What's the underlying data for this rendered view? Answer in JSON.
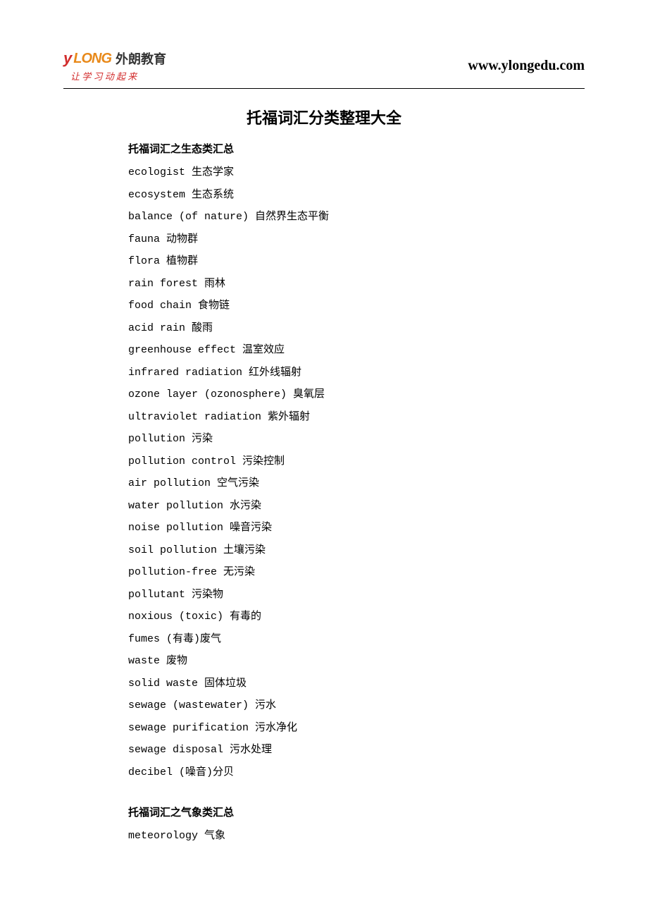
{
  "header": {
    "logo_en": "LONG",
    "logo_cn": "外朗教育",
    "slogan": "让 学 习 动 起 来",
    "url": "www.ylongedu.com"
  },
  "title": "托福词汇分类整理大全",
  "sections": [
    {
      "heading": "托福词汇之生态类汇总",
      "entries": [
        "ecologist 生态学家",
        "ecosystem 生态系统",
        "balance (of nature) 自然界生态平衡",
        "fauna 动物群",
        "flora 植物群",
        "rain forest 雨林",
        "food chain 食物链",
        "acid rain 酸雨",
        "greenhouse effect 温室效应",
        "infrared radiation 红外线辐射",
        "ozone layer (ozonosphere) 臭氧层",
        "ultraviolet radiation 紫外辐射",
        "pollution 污染",
        "pollution control 污染控制",
        "air pollution 空气污染",
        "water pollution 水污染",
        "noise pollution 噪音污染",
        "soil pollution 土壤污染",
        "pollution-free 无污染",
        "pollutant 污染物",
        "noxious (toxic) 有毒的",
        "fumes (有毒)废气",
        "waste 废物",
        "solid waste 固体垃圾",
        "sewage (wastewater) 污水",
        "sewage purification 污水净化",
        "sewage disposal 污水处理",
        "decibel (噪音)分贝"
      ]
    },
    {
      "heading": "托福词汇之气象类汇总",
      "entries": [
        "meteorology 气象"
      ]
    }
  ]
}
